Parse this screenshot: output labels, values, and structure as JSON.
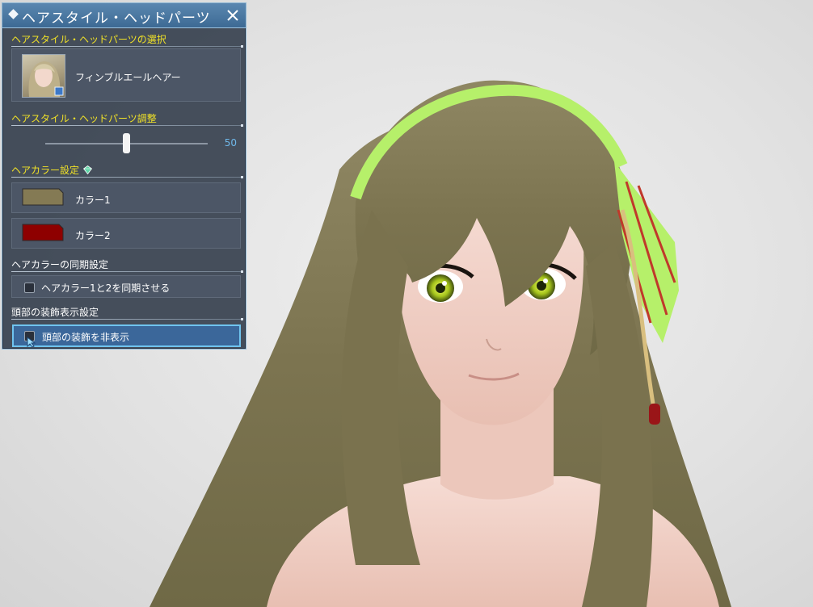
{
  "window": {
    "title": "ヘアスタイル・ヘッドパーツ",
    "close_icon": "close-icon"
  },
  "sections": {
    "select": {
      "heading": "ヘアスタイル・ヘッドパーツの選択",
      "item_name": "フィンブルエールヘアー"
    },
    "adjust": {
      "heading": "ヘアスタイル・ヘッドパーツ調整",
      "slider_value": "50",
      "slider_level": 0.5
    },
    "color": {
      "heading": "ヘアカラー設定",
      "colors": [
        {
          "label": "カラー1",
          "hex": "#847a54"
        },
        {
          "label": "カラー2",
          "hex": "#8e0000"
        }
      ]
    },
    "sync": {
      "heading": "ヘアカラーの同期設定",
      "checkbox_label": "ヘアカラー1と2を同期させる",
      "checked": false
    },
    "head_deco": {
      "heading": "頭部の装飾表示設定",
      "checkbox_label": "頭部の装飾を非表示",
      "checked": false
    }
  },
  "theme": {
    "accent_yellow": "#f1e227",
    "title_blue": "#3d6a94",
    "value_blue": "#6fb8ea",
    "hair_color": "#847a54",
    "ribbon_green": "#b6f06a"
  }
}
